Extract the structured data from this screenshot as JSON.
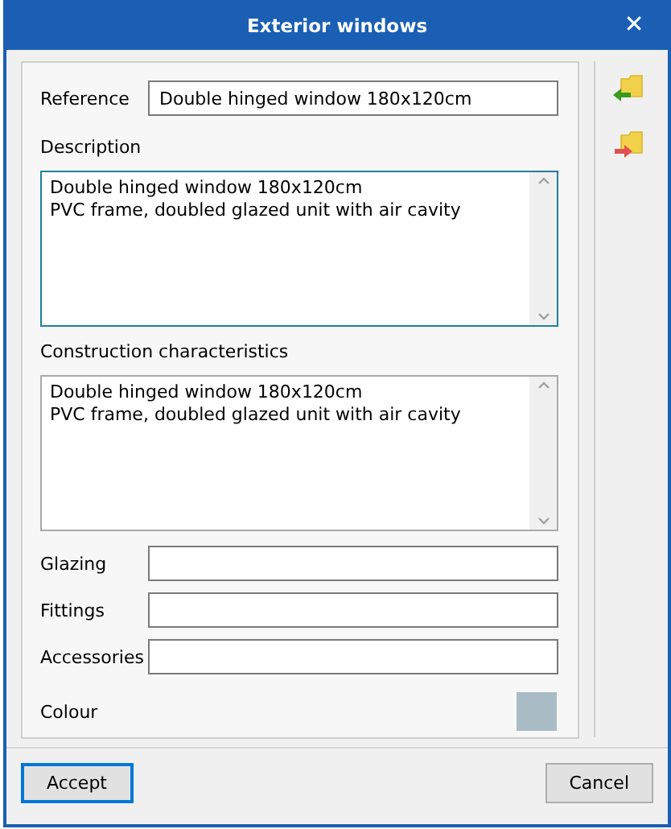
{
  "window": {
    "title": "Exterior windows",
    "close": "✕"
  },
  "fields": [
    {
      "kind": "text",
      "label": "Reference",
      "value": "Double hinged window 180x120cm"
    },
    {
      "kind": "textarea",
      "label": "Description",
      "value": "Double hinged window 180x120cm\nPVC frame, doubled glazed unit with air cavity",
      "focused": true
    },
    {
      "kind": "textarea",
      "label": "Construction characteristics",
      "value": "Double hinged window 180x120cm\nPVC frame, doubled glazed unit with air cavity",
      "focused": false
    },
    {
      "kind": "text",
      "label": "Glazing"
    },
    {
      "kind": "text",
      "label": "Fittings"
    },
    {
      "kind": "text",
      "label": "Accessories"
    },
    {
      "kind": "color",
      "label": "Colour",
      "color": "#a9bbc5"
    }
  ],
  "side_tools": [
    {
      "kind": "import"
    },
    {
      "kind": "export"
    }
  ],
  "buttons": [
    {
      "label": "Accept",
      "default": true
    },
    {
      "label": "Cancel",
      "default": false
    }
  ]
}
